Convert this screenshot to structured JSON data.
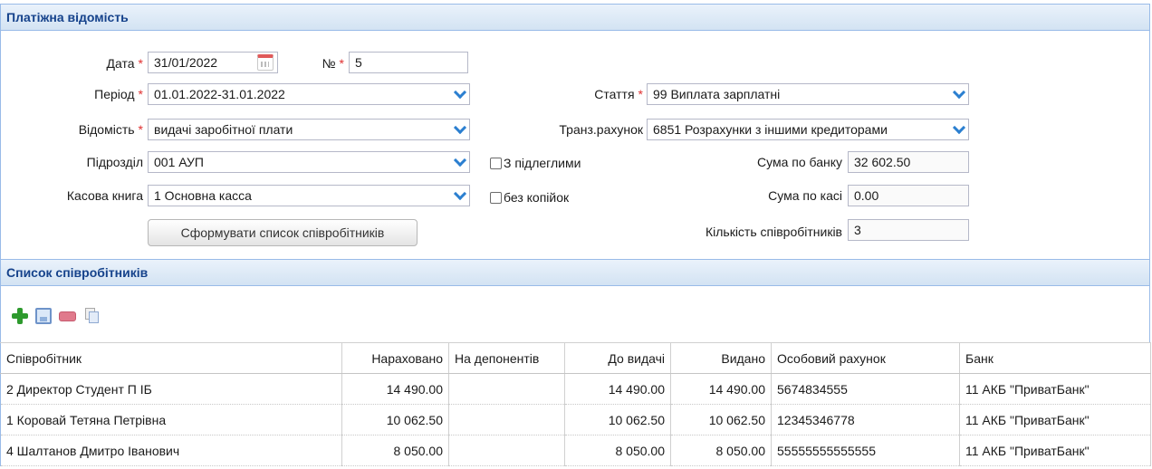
{
  "form": {
    "title": "Платіжна відомість",
    "date_label": "Дата",
    "date_value": "31/01/2022",
    "number_label": "№",
    "number_value": "5",
    "period_label": "Період",
    "period_value": "01.01.2022-31.01.2022",
    "article_label": "Стаття",
    "article_value": "99 Виплата зарплатні",
    "statement_label": "Відомість",
    "statement_value": "видачі заробітної плати",
    "transit_label": "Транз.рахунок",
    "transit_value": "6851 Розрахунки з іншими кредиторами",
    "department_label": "Підрозділ",
    "department_value": "001 АУП",
    "subordinates_label": "З підлеглими",
    "bank_sum_label": "Сума по банку",
    "bank_sum_value": "32 602.50",
    "cashbook_label": "Касова книга",
    "cashbook_value": "1 Основна касса",
    "no_kopecks_label": "без копійок",
    "cash_sum_label": "Сума по касі",
    "cash_sum_value": "0.00",
    "employee_count_label": "Кількість співробітників",
    "employee_count_value": "3",
    "generate_button": "Сформувати список співробітників",
    "required_mark": "*"
  },
  "employees": {
    "title": "Список співробітників",
    "toolbar_icons": [
      "add-icon",
      "save-icon",
      "delete-icon",
      "copy-icon"
    ],
    "columns": [
      "Співробітник",
      "Нараховано",
      "На депонентів",
      "До видачі",
      "Видано",
      "Особовий рахунок",
      "Банк"
    ],
    "rows": [
      [
        "2 Директор Студент П ІБ",
        "14 490.00",
        "",
        "14 490.00",
        "14 490.00",
        "5674834555",
        "11 АКБ \"ПриватБанк\""
      ],
      [
        "1 Коровай Тетяна Петрівна",
        "10 062.50",
        "",
        "10 062.50",
        "10 062.50",
        "12345346778",
        "11 АКБ \"ПриватБанк\""
      ],
      [
        "4 Шалтанов Дмитро Іванович",
        "8 050.00",
        "",
        "8 050.00",
        "8 050.00",
        "55555555555555",
        "11 АКБ \"ПриватБанк\""
      ]
    ]
  },
  "colors": {
    "header_text": "#15428b",
    "header_border": "#99bbe8",
    "required": "#e03030",
    "chevron": "#2b7fd0"
  }
}
